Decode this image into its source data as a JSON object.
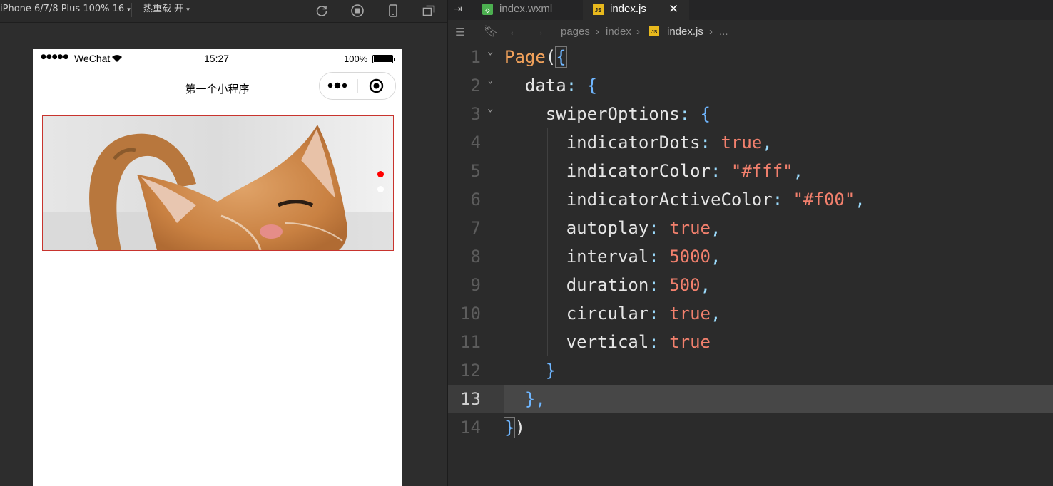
{
  "simulator": {
    "device_label": "iPhone 6/7/8 Plus 100% 16",
    "hot_reload_label": "热重载 开",
    "toolbar_icons": [
      "refresh-icon",
      "stop-icon",
      "phone-icon",
      "window-icon"
    ],
    "status": {
      "signal": "●●●●●",
      "carrier": "WeChat",
      "time": "15:27",
      "battery": "100%"
    },
    "nav_title": "第一个小程序",
    "indicator_active_color": "#ff0000",
    "indicator_color": "#ffffff"
  },
  "editor": {
    "tabs": [
      {
        "label": "index.wxml",
        "icon": "wxml-file-icon",
        "active": false
      },
      {
        "label": "index.js",
        "icon": "js-file-icon",
        "active": true
      }
    ],
    "breadcrumb": [
      "pages",
      "index",
      "index.js",
      "..."
    ],
    "current_line": 13,
    "lines": [
      {
        "n": "1"
      },
      {
        "n": "2"
      },
      {
        "n": "3"
      },
      {
        "n": "4"
      },
      {
        "n": "5"
      },
      {
        "n": "6"
      },
      {
        "n": "7"
      },
      {
        "n": "8"
      },
      {
        "n": "9"
      },
      {
        "n": "10"
      },
      {
        "n": "11"
      },
      {
        "n": "12"
      },
      {
        "n": "13"
      },
      {
        "n": "14"
      }
    ],
    "code": {
      "l1_fn": "Page",
      "l1_p": "(",
      "l1_b": "{",
      "l2_prop": "data",
      "l2_p": ": ",
      "l2_b": "{",
      "l3_prop": "swiperOptions",
      "l3_p": ": ",
      "l3_b": "{",
      "l4_prop": "indicatorDots",
      "l4_val": "true",
      "l5_prop": "indicatorColor",
      "l5_val": "\"#fff\"",
      "l6_prop": "indicatorActiveColor",
      "l6_val": "\"#f00\"",
      "l7_prop": "autoplay",
      "l7_val": "true",
      "l8_prop": "interval",
      "l8_val": "5000",
      "l9_prop": "duration",
      "l9_val": "500",
      "l10_prop": "circular",
      "l10_val": "true",
      "l11_prop": "vertical",
      "l11_val": "true",
      "l12": "}",
      "l13": "},",
      "l14_b": "}",
      "l14_p": ")",
      "colon": ": ",
      "comma": ","
    }
  }
}
